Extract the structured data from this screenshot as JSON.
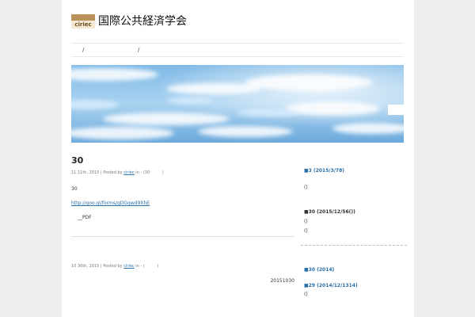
{
  "header": {
    "logo_text": "ciriec",
    "title": "国際公共経済学会"
  },
  "nav": {
    "sep1": "/",
    "sep2": "/"
  },
  "post1": {
    "title": "30",
    "meta_date": "11 11th, 2015 | Posted by",
    "meta_author": "ciriec",
    "meta_in": "in",
    "meta_category": "- (30",
    "meta_close": ")",
    "body_line1": "30",
    "link": "http://goo.gl/forms/gDGqwd9XhE",
    "pdf_label": "__PDF"
  },
  "post2": {
    "meta_date": "10 30th, 2015 | Posted by",
    "meta_author": "ciriec",
    "meta_in": "in",
    "meta_category": "- (",
    "meta_close": ")",
    "date_text": "20151030"
  },
  "sidebar": {
    "item1_heading": "■3 (2015/3/78)",
    "item1_line": "()",
    "item2_heading": "■30 (2015/12/56())",
    "item2_line1": "()",
    "item2_line2": "()",
    "item3_heading": "■30 (2014)",
    "item4_heading": "■29 (2014/12/1314)",
    "item4_line": "()"
  }
}
